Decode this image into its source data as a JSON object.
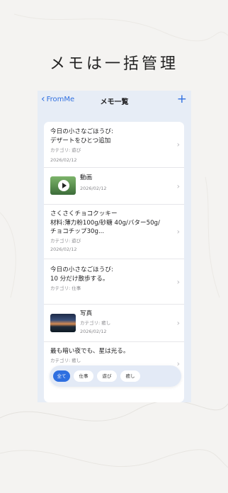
{
  "headline": "メモは一括管理",
  "nav": {
    "back_label": "FromMe",
    "title": "メモ一覧",
    "add_label": "+"
  },
  "memos": [
    {
      "title_line1": "今日の小さなごほうび:",
      "title_line2": "デザートをひとつ追加",
      "category": "カテゴリ: 遊び",
      "date": "2026/02/12"
    },
    {
      "title": "動画",
      "date": "2026/02/12"
    },
    {
      "title_line1": "さくさくチョコクッキー",
      "title_line2": "材料:薄力粉100g/砂糖 40g/バター50g/",
      "title_line3": "チョコチップ30g...",
      "category": "カテゴリ: 遊び",
      "date": "2026/02/12"
    },
    {
      "title_line1": "今日の小さなごほうび:",
      "title_line2": "10 分だけ散歩する。",
      "category": "カテゴリ: 仕事"
    },
    {
      "title": "写真",
      "category": "カテゴリ: 癒し",
      "date": "2026/02/12"
    },
    {
      "title": "最も暗い夜でも、星は光る。",
      "category": "カテゴリ: 癒し"
    }
  ],
  "filters": [
    "全て",
    "仕事",
    "遊び",
    "癒し"
  ],
  "colors": {
    "accent": "#2f6fe0",
    "background": "#e7edf6"
  }
}
